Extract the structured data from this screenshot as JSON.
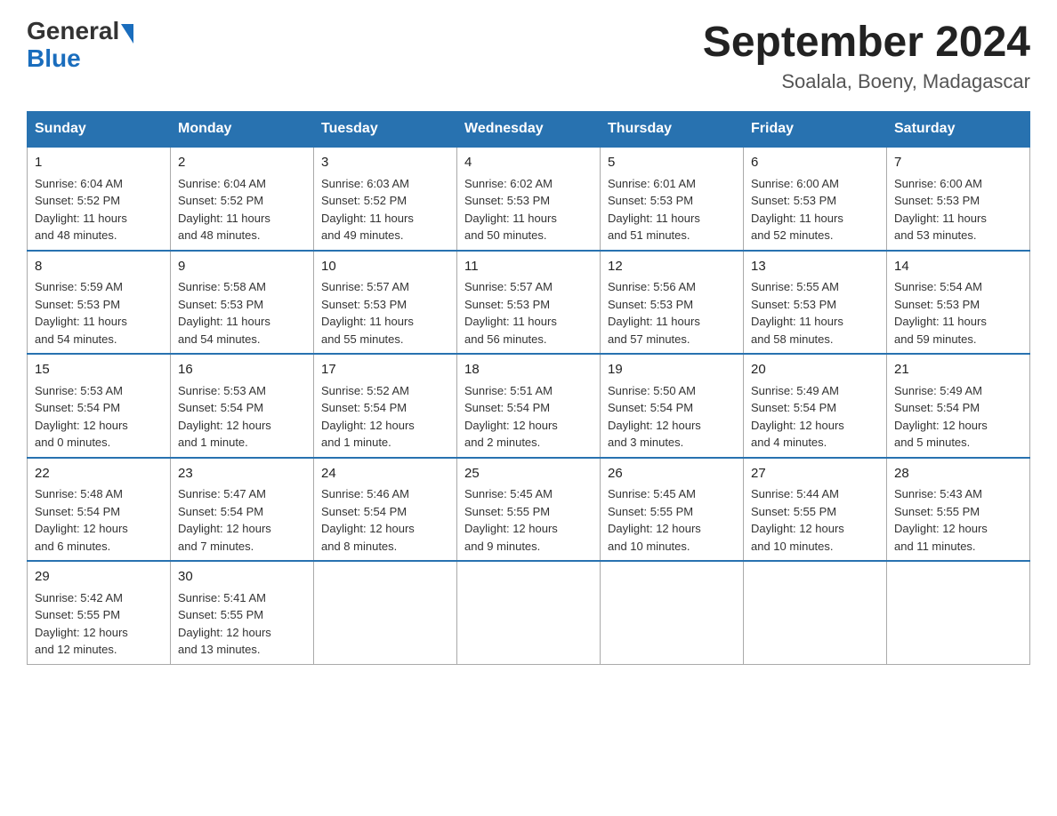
{
  "header": {
    "logo_general": "General",
    "logo_blue": "Blue",
    "title": "September 2024",
    "subtitle": "Soalala, Boeny, Madagascar"
  },
  "days_of_week": [
    "Sunday",
    "Monday",
    "Tuesday",
    "Wednesday",
    "Thursday",
    "Friday",
    "Saturday"
  ],
  "weeks": [
    [
      {
        "day": "1",
        "sunrise": "6:04 AM",
        "sunset": "5:52 PM",
        "daylight": "11 hours and 48 minutes."
      },
      {
        "day": "2",
        "sunrise": "6:04 AM",
        "sunset": "5:52 PM",
        "daylight": "11 hours and 48 minutes."
      },
      {
        "day": "3",
        "sunrise": "6:03 AM",
        "sunset": "5:52 PM",
        "daylight": "11 hours and 49 minutes."
      },
      {
        "day": "4",
        "sunrise": "6:02 AM",
        "sunset": "5:53 PM",
        "daylight": "11 hours and 50 minutes."
      },
      {
        "day": "5",
        "sunrise": "6:01 AM",
        "sunset": "5:53 PM",
        "daylight": "11 hours and 51 minutes."
      },
      {
        "day": "6",
        "sunrise": "6:00 AM",
        "sunset": "5:53 PM",
        "daylight": "11 hours and 52 minutes."
      },
      {
        "day": "7",
        "sunrise": "6:00 AM",
        "sunset": "5:53 PM",
        "daylight": "11 hours and 53 minutes."
      }
    ],
    [
      {
        "day": "8",
        "sunrise": "5:59 AM",
        "sunset": "5:53 PM",
        "daylight": "11 hours and 54 minutes."
      },
      {
        "day": "9",
        "sunrise": "5:58 AM",
        "sunset": "5:53 PM",
        "daylight": "11 hours and 54 minutes."
      },
      {
        "day": "10",
        "sunrise": "5:57 AM",
        "sunset": "5:53 PM",
        "daylight": "11 hours and 55 minutes."
      },
      {
        "day": "11",
        "sunrise": "5:57 AM",
        "sunset": "5:53 PM",
        "daylight": "11 hours and 56 minutes."
      },
      {
        "day": "12",
        "sunrise": "5:56 AM",
        "sunset": "5:53 PM",
        "daylight": "11 hours and 57 minutes."
      },
      {
        "day": "13",
        "sunrise": "5:55 AM",
        "sunset": "5:53 PM",
        "daylight": "11 hours and 58 minutes."
      },
      {
        "day": "14",
        "sunrise": "5:54 AM",
        "sunset": "5:53 PM",
        "daylight": "11 hours and 59 minutes."
      }
    ],
    [
      {
        "day": "15",
        "sunrise": "5:53 AM",
        "sunset": "5:54 PM",
        "daylight": "12 hours and 0 minutes."
      },
      {
        "day": "16",
        "sunrise": "5:53 AM",
        "sunset": "5:54 PM",
        "daylight": "12 hours and 1 minute."
      },
      {
        "day": "17",
        "sunrise": "5:52 AM",
        "sunset": "5:54 PM",
        "daylight": "12 hours and 1 minute."
      },
      {
        "day": "18",
        "sunrise": "5:51 AM",
        "sunset": "5:54 PM",
        "daylight": "12 hours and 2 minutes."
      },
      {
        "day": "19",
        "sunrise": "5:50 AM",
        "sunset": "5:54 PM",
        "daylight": "12 hours and 3 minutes."
      },
      {
        "day": "20",
        "sunrise": "5:49 AM",
        "sunset": "5:54 PM",
        "daylight": "12 hours and 4 minutes."
      },
      {
        "day": "21",
        "sunrise": "5:49 AM",
        "sunset": "5:54 PM",
        "daylight": "12 hours and 5 minutes."
      }
    ],
    [
      {
        "day": "22",
        "sunrise": "5:48 AM",
        "sunset": "5:54 PM",
        "daylight": "12 hours and 6 minutes."
      },
      {
        "day": "23",
        "sunrise": "5:47 AM",
        "sunset": "5:54 PM",
        "daylight": "12 hours and 7 minutes."
      },
      {
        "day": "24",
        "sunrise": "5:46 AM",
        "sunset": "5:54 PM",
        "daylight": "12 hours and 8 minutes."
      },
      {
        "day": "25",
        "sunrise": "5:45 AM",
        "sunset": "5:55 PM",
        "daylight": "12 hours and 9 minutes."
      },
      {
        "day": "26",
        "sunrise": "5:45 AM",
        "sunset": "5:55 PM",
        "daylight": "12 hours and 10 minutes."
      },
      {
        "day": "27",
        "sunrise": "5:44 AM",
        "sunset": "5:55 PM",
        "daylight": "12 hours and 10 minutes."
      },
      {
        "day": "28",
        "sunrise": "5:43 AM",
        "sunset": "5:55 PM",
        "daylight": "12 hours and 11 minutes."
      }
    ],
    [
      {
        "day": "29",
        "sunrise": "5:42 AM",
        "sunset": "5:55 PM",
        "daylight": "12 hours and 12 minutes."
      },
      {
        "day": "30",
        "sunrise": "5:41 AM",
        "sunset": "5:55 PM",
        "daylight": "12 hours and 13 minutes."
      },
      null,
      null,
      null,
      null,
      null
    ]
  ],
  "labels": {
    "sunrise": "Sunrise:",
    "sunset": "Sunset:",
    "daylight": "Daylight:"
  }
}
